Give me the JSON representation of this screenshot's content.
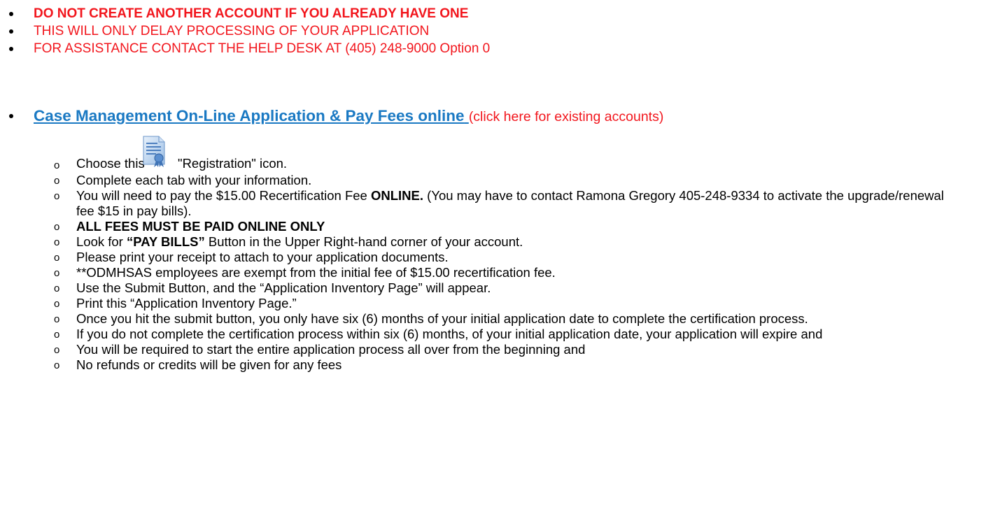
{
  "warnings": {
    "line1": "DO NOT CREATE ANOTHER ACCOUNT IF YOU ALREADY HAVE ONE",
    "line2": "THIS WILL ONLY DELAY PROCESSING OF YOUR APPLICATION",
    "line3": "FOR ASSISTANCE CONTACT THE HELP DESK AT (405) 248-9000 Option 0"
  },
  "case_management": {
    "link_text": "Case Management On-Line Application & Pay Fees online",
    "link_note": "(click here for existing accounts)"
  },
  "steps": {
    "choose_prefix": "Choose this",
    "choose_suffix": "\"Registration\" icon.",
    "registration_icon": "registration-certificate-icon",
    "complete_tabs": "Complete each tab with your information.",
    "pay_fee_prefix": "You will need to pay the $15.00 Recertification Fee ",
    "pay_fee_bold": "ONLINE.",
    "pay_fee_suffix": " (You may have to contact Ramona Gregory 405-248-9334 to activate the upgrade/renewal fee $15 in pay bills).",
    "fees_online": "ALL FEES MUST BE PAID ONLINE ONLY",
    "look_prefix": "Look for ",
    "look_bold": "“PAY BILLS”",
    "look_suffix": " Button in the Upper Right-hand corner of your account.",
    "print_receipt": "Please print your receipt to attach to your application documents.",
    "exempt": "**ODMHSAS employees are exempt from the initial fee of $15.00 recertification fee.",
    "submit": "Use the Submit Button, and the “Application Inventory Page” will appear.",
    "print_inventory": "Print this “Application Inventory Page.”",
    "six_months": "Once you hit the submit button, you only have six (6) months of your initial application date to complete the certification process.",
    "expire": "If you do not complete the certification process within six (6) months, of your initial application date, your application will expire and",
    "restart": "You will be required to start the entire application process all over from the beginning and",
    "no_refunds": "No refunds or credits will be given for any fees"
  },
  "colors": {
    "warning_red": "#f2161d",
    "link_blue": "#1a79c3"
  }
}
